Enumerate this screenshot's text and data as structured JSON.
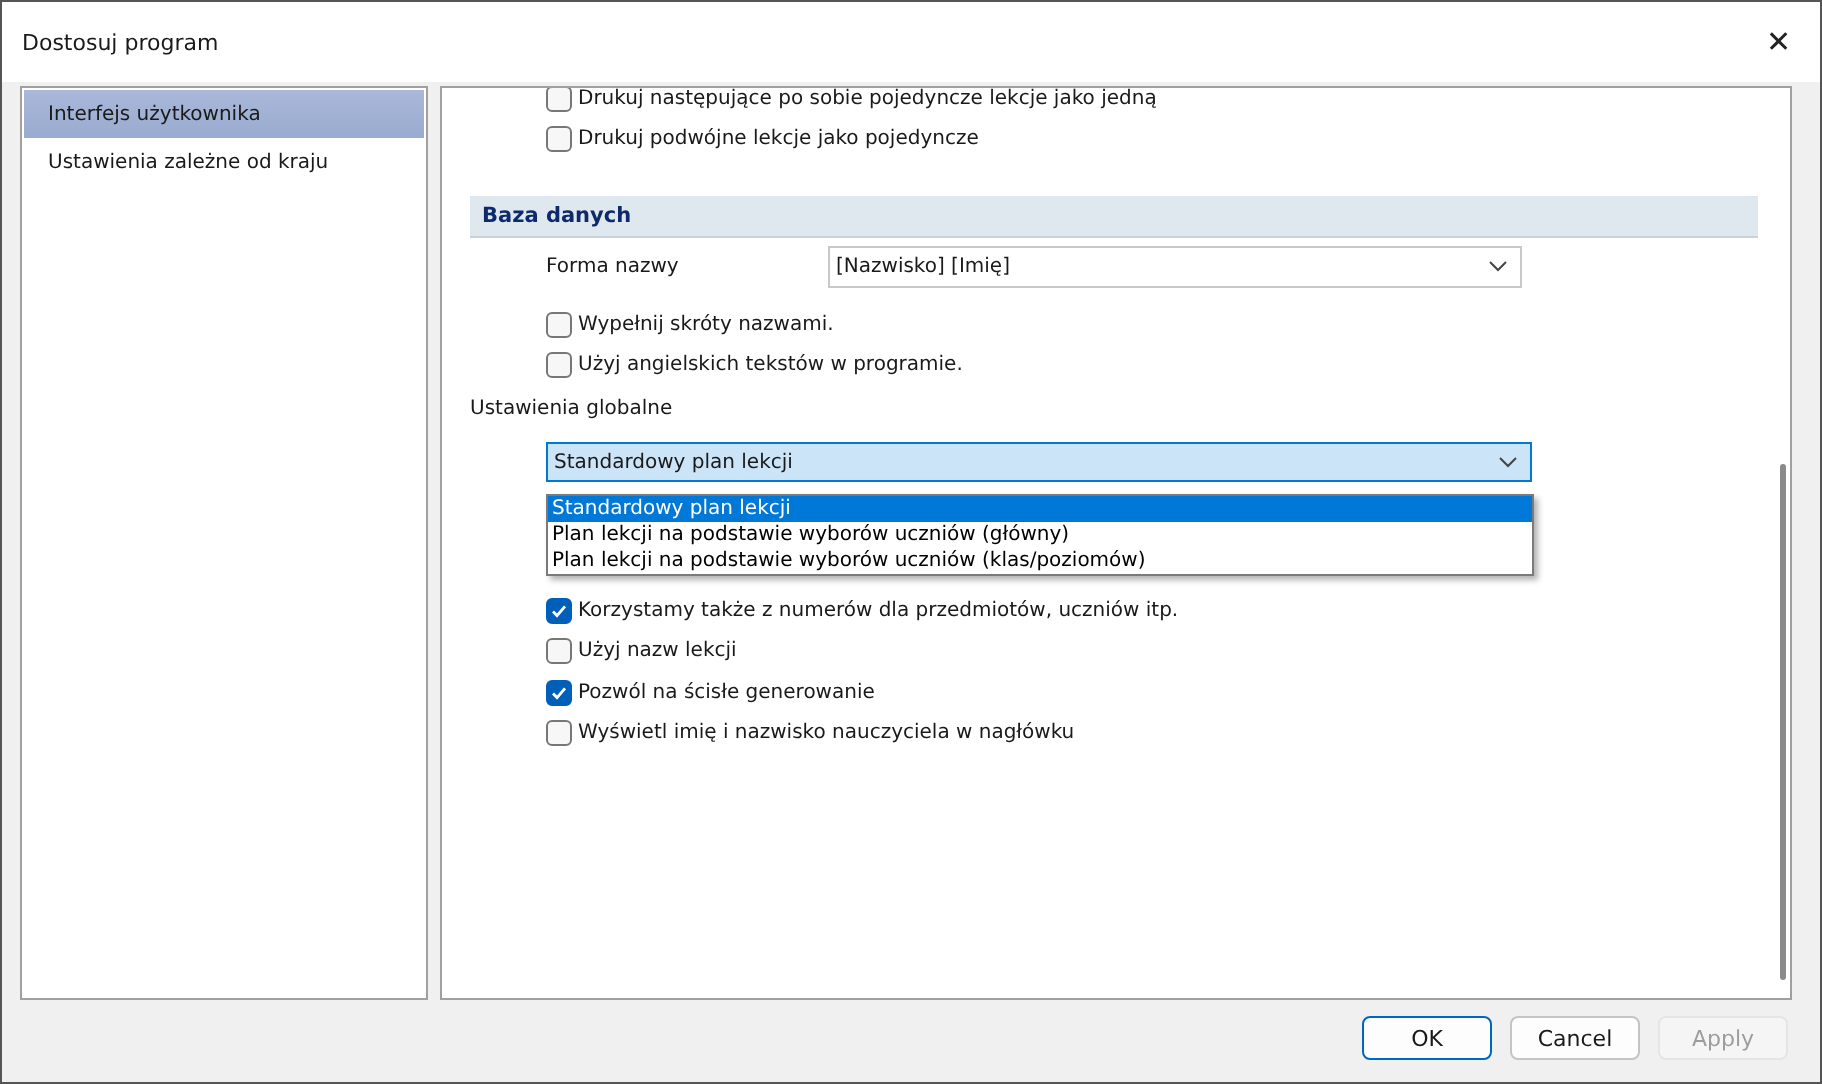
{
  "window": {
    "title": "Dostosuj program",
    "close": "✕"
  },
  "sidebar": {
    "items": [
      {
        "label": "Interfejs użytkownika",
        "selected": true
      },
      {
        "label": "Ustawienia zależne od kraju",
        "selected": false
      }
    ]
  },
  "print_options": [
    {
      "label": "Drukuj następujące po sobie pojedyncze lekcje jako jedną",
      "checked": false
    },
    {
      "label": "Drukuj podwójne lekcje jako pojedyncze",
      "checked": false
    }
  ],
  "database": {
    "heading": "Baza danych",
    "name_form": {
      "label": "Forma nazwy",
      "value": "[Nazwisko] [Imię]"
    },
    "options": [
      {
        "label": "Wypełnij skróty nazwami.",
        "checked": false
      },
      {
        "label": "Użyj angielskich tekstów w programie.",
        "checked": false
      }
    ]
  },
  "global": {
    "label": "Ustawienia globalne",
    "combo": {
      "value": "Standardowy plan lekcji",
      "expanded": true,
      "options": [
        {
          "label": "Standardowy plan lekcji",
          "selected": true
        },
        {
          "label": "Plan lekcji na podstawie wyborów uczniów (główny)",
          "selected": false
        },
        {
          "label": "Plan lekcji na podstawie wyborów uczniów (klas/poziomów)",
          "selected": false
        }
      ]
    },
    "options": [
      {
        "label": "Korzystamy także z numerów dla przedmiotów, uczniów itp.",
        "checked": true
      },
      {
        "label": "Użyj nazw lekcji",
        "checked": false
      },
      {
        "label": "Pozwól na ścisłe generowanie",
        "checked": true
      },
      {
        "label": "Wyświetl imię i nazwisko nauczyciela w nagłówku",
        "checked": false
      }
    ]
  },
  "buttons": [
    {
      "label": "OK",
      "disabled": false,
      "default": true
    },
    {
      "label": "Cancel",
      "disabled": false,
      "default": false
    },
    {
      "label": "Apply",
      "disabled": true,
      "default": false
    }
  ]
}
